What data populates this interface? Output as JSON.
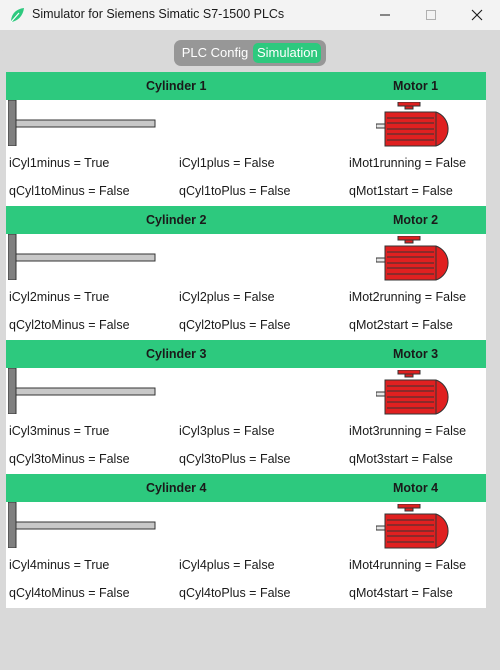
{
  "window": {
    "title": "Simulator for Siemens Simatic S7-1500 PLCs",
    "controls": {
      "minimize": "—",
      "maximize": "☐",
      "close": "✕"
    },
    "icon": "leaf-icon"
  },
  "tabs": [
    {
      "label": "PLC Config",
      "active": false
    },
    {
      "label": "Simulation",
      "active": true
    }
  ],
  "colors": {
    "accent": "#2dc97e",
    "motor": "#e02020",
    "cylinder_body": "#c8c8c8",
    "cylinder_end": "#808080"
  },
  "sections": [
    {
      "cylinder_title": "Cylinder 1",
      "motor_title": "Motor 1",
      "row1": [
        "iCyl1minus = True",
        "iCyl1plus = False",
        "iMot1running = False"
      ],
      "row2": [
        "qCyl1toMinus = False",
        "qCyl1toPlus = False",
        "qMot1start = False"
      ]
    },
    {
      "cylinder_title": "Cylinder 2",
      "motor_title": "Motor 2",
      "row1": [
        "iCyl2minus = True",
        "iCyl2plus = False",
        "iMot2running = False"
      ],
      "row2": [
        "qCyl2toMinus = False",
        "qCyl2toPlus = False",
        "qMot2start = False"
      ]
    },
    {
      "cylinder_title": "Cylinder 3",
      "motor_title": "Motor 3",
      "row1": [
        "iCyl3minus = True",
        "iCyl3plus = False",
        "iMot3running = False"
      ],
      "row2": [
        "qCyl3toMinus = False",
        "qCyl3toPlus = False",
        "qMot3start = False"
      ]
    },
    {
      "cylinder_title": "Cylinder 4",
      "motor_title": "Motor 4",
      "row1": [
        "iCyl4minus = True",
        "iCyl4plus = False",
        "iMot4running = False"
      ],
      "row2": [
        "qCyl4toMinus = False",
        "qCyl4toPlus = False",
        "qMot4start = False"
      ]
    }
  ]
}
